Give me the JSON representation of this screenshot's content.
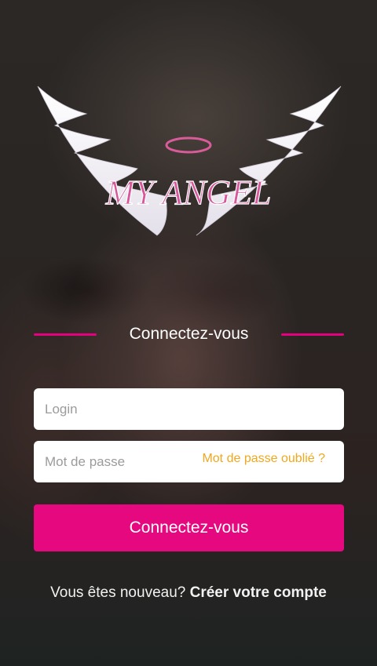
{
  "brand": {
    "logo_text": "MY ANGEL",
    "accent": "#e5007f",
    "link_color": "#f0a81c"
  },
  "login_section": {
    "heading": "Connectez-vous"
  },
  "form": {
    "login_placeholder": "Login",
    "password_placeholder": "Mot de passe",
    "forgot_password": "Mot de passe oublié ?",
    "submit_label": "Connectez-vous"
  },
  "footer": {
    "new_user_text": "Vous êtes nouveau?",
    "create_account": "Créer votre compte"
  }
}
